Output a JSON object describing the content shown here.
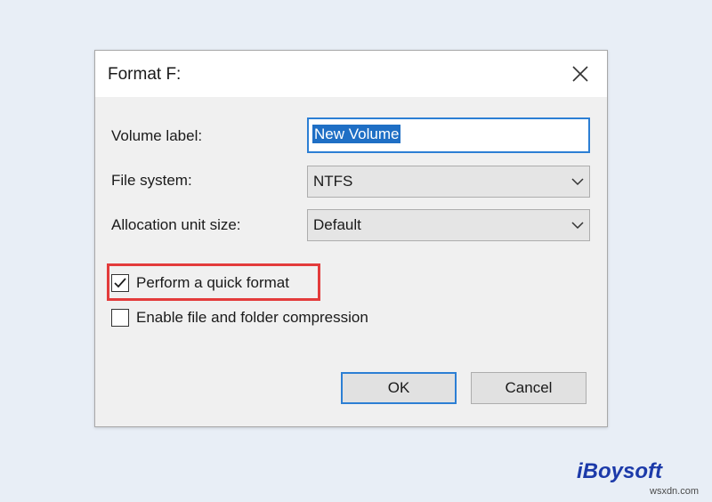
{
  "dialog": {
    "title": "Format F:",
    "volume_label": {
      "label": "Volume label:",
      "value": "New Volume"
    },
    "file_system": {
      "label": "File system:",
      "value": "NTFS"
    },
    "allocation": {
      "label": "Allocation unit size:",
      "value": "Default"
    },
    "quick_format": {
      "label": "Perform a quick format",
      "checked": true
    },
    "compression": {
      "label": "Enable file and folder compression",
      "checked": false
    },
    "ok_label": "OK",
    "cancel_label": "Cancel"
  },
  "icons": {
    "close": "close-icon",
    "dropdown": "chevron-down-icon",
    "check": "check-icon"
  },
  "colors": {
    "focus_blue": "#2c7fd4",
    "selection": "#1f6fc5",
    "highlight_red": "#e33b3b",
    "brand_blue": "#1c3aa9"
  },
  "branding": {
    "logo": "iBoysoft",
    "watermark": "wsxdn.com"
  }
}
